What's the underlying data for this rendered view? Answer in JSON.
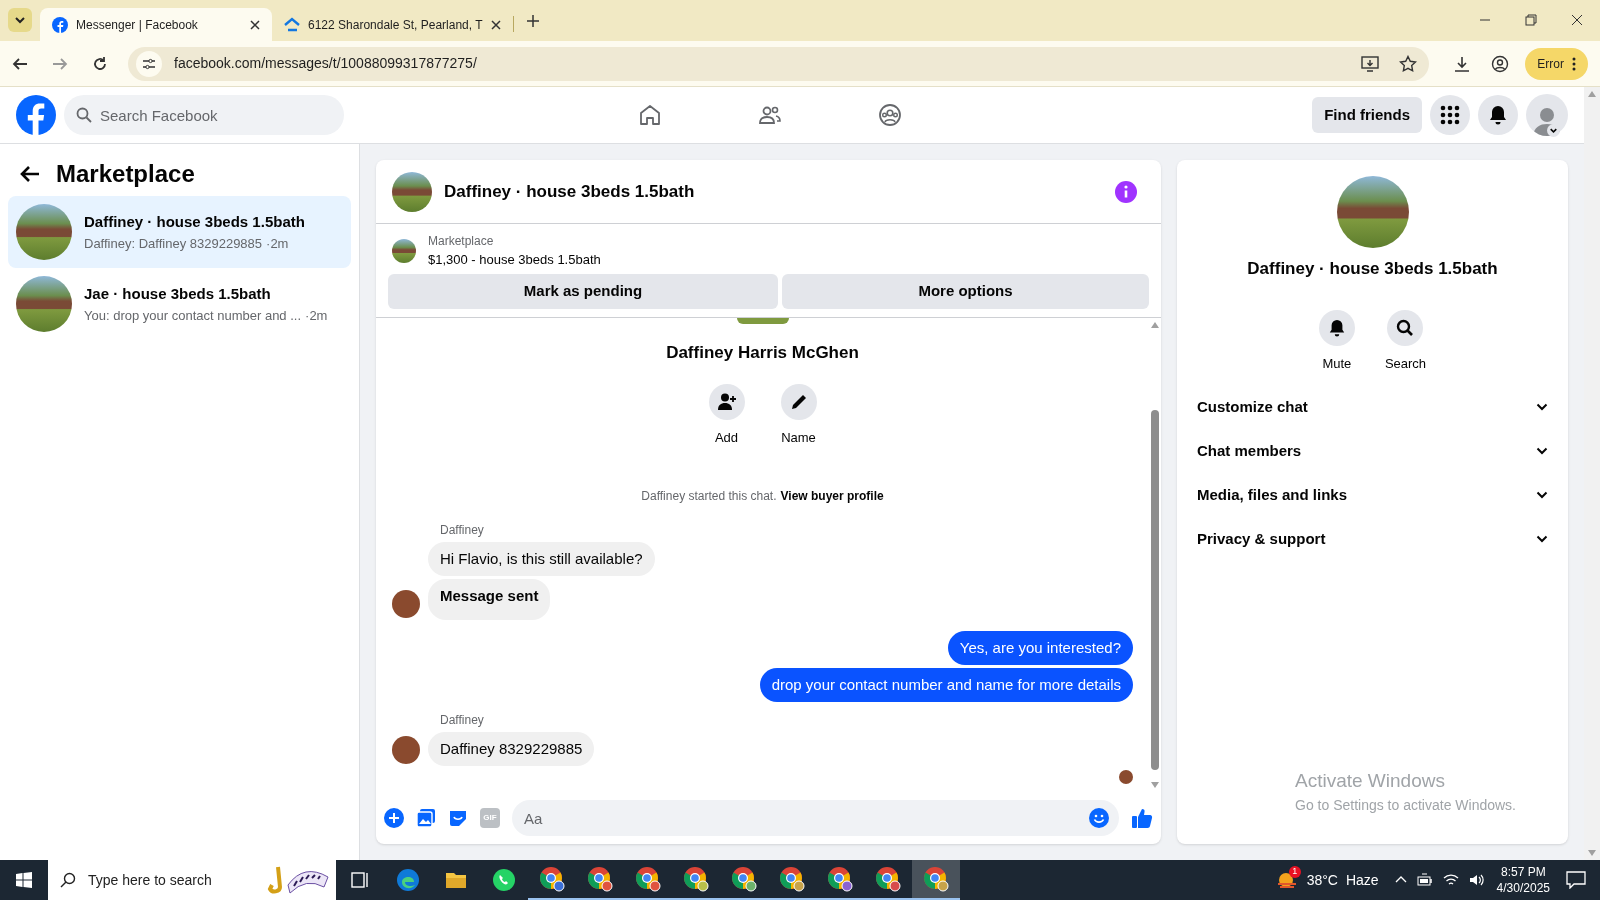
{
  "browser": {
    "tabs": [
      {
        "title": "Messenger | Facebook",
        "selected": true,
        "kind": "facebook"
      },
      {
        "title": "6122 Sharondale St, Pearland, T",
        "selected": false,
        "kind": "zillow"
      }
    ],
    "address": "facebook.com/messages/t/10088099317877275/",
    "profile_button": "Error"
  },
  "header": {
    "search_placeholder": "Search Facebook",
    "find_friends": "Find friends"
  },
  "sidebar": {
    "title": "Marketplace",
    "conversations": [
      {
        "title": "Daffiney · house 3beds 1.5bath",
        "preview": "Daffiney: Daffiney 8329229885",
        "time": "·2m",
        "selected": true
      },
      {
        "title": "Jae · house 3beds 1.5bath",
        "preview": "You: drop your contact number and ...",
        "time": "·2m",
        "selected": false
      }
    ]
  },
  "chat": {
    "title": "Daffiney · house 3beds 1.5bath",
    "listing": {
      "label": "Marketplace",
      "text": "$1,300 - house 3beds 1.5bath"
    },
    "buttons": [
      "Mark as pending",
      "More options"
    ],
    "profile_name": "Daffiney Harris McGhen",
    "profile_actions": [
      {
        "kind": "add",
        "label": "Add"
      },
      {
        "kind": "name",
        "label": "Name"
      }
    ],
    "notice": {
      "text": "Daffiney started this chat.",
      "link": "View buyer profile"
    },
    "messages": [
      {
        "outgoing": false,
        "sender": "Daffiney",
        "text": "Hi Flavio, is this still available?",
        "kind": "text",
        "avatar": false
      },
      {
        "outgoing": false,
        "text": "Message sent",
        "kind": "status",
        "avatar": true
      },
      {
        "outgoing": true,
        "text": "Yes, are you interested?",
        "kind": "text",
        "avatar": false
      },
      {
        "outgoing": true,
        "text": "drop your contact number and name for more details",
        "kind": "text",
        "avatar": false
      },
      {
        "outgoing": false,
        "sender": "Daffiney",
        "text": "Daffiney 8329229885",
        "kind": "text",
        "avatar": true
      }
    ],
    "gif_label": "GIF",
    "composer_placeholder": "Aa"
  },
  "details": {
    "name": "Daffiney · house 3beds 1.5bath",
    "actions": [
      {
        "kind": "mute",
        "label": "Mute"
      },
      {
        "kind": "search",
        "label": "Search"
      }
    ],
    "sections": [
      {
        "label": "Customize chat",
        "expanded": false
      },
      {
        "label": "Chat members",
        "expanded": false
      },
      {
        "label": "Media, files and links",
        "expanded": false
      },
      {
        "label": "Privacy & support",
        "expanded": false
      }
    ]
  },
  "activation": {
    "title": "Activate Windows",
    "subtitle": "Go to Settings to activate Windows."
  },
  "taskbar": {
    "search_placeholder": "Type here to search",
    "weather_badge": "1",
    "temperature": "38°C",
    "condition": "Haze",
    "time": "8:57 PM",
    "date": "4/30/2025"
  }
}
